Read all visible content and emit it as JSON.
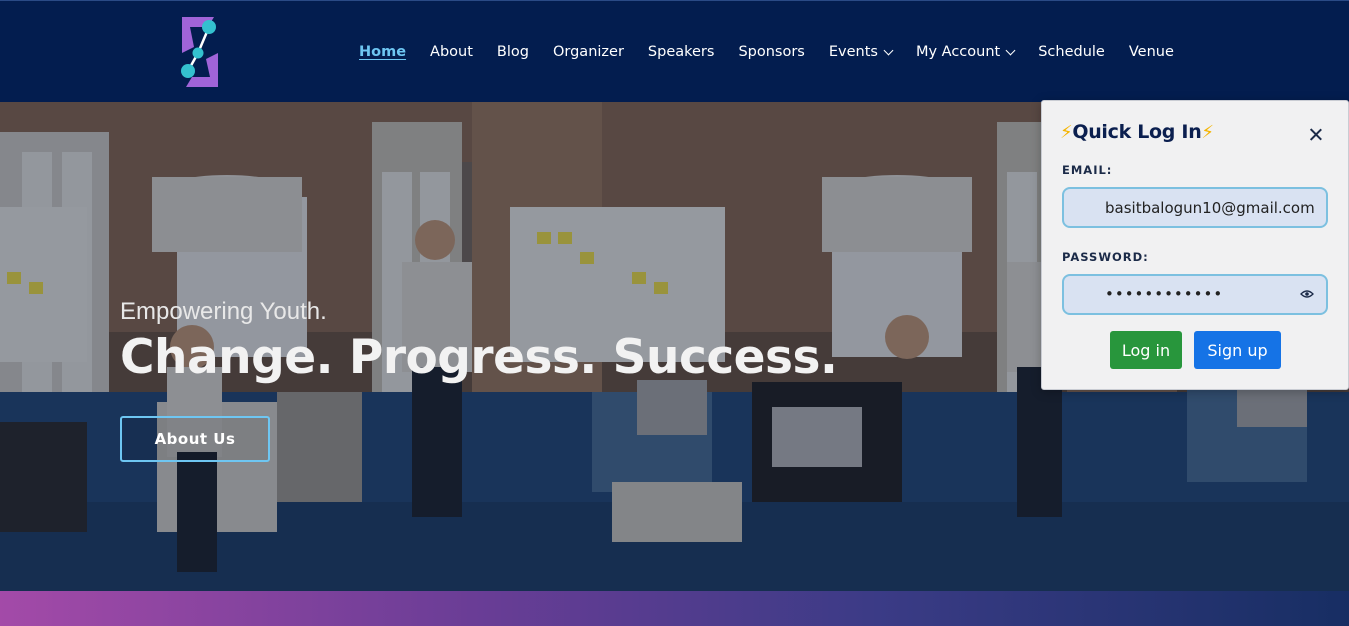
{
  "nav": {
    "items": [
      {
        "label": "Home",
        "active": true,
        "dropdown": false
      },
      {
        "label": "About",
        "active": false,
        "dropdown": false
      },
      {
        "label": "Blog",
        "active": false,
        "dropdown": false
      },
      {
        "label": "Organizer",
        "active": false,
        "dropdown": false
      },
      {
        "label": "Speakers",
        "active": false,
        "dropdown": false
      },
      {
        "label": "Sponsors",
        "active": false,
        "dropdown": false
      },
      {
        "label": "Events",
        "active": false,
        "dropdown": true
      },
      {
        "label": "My Account",
        "active": false,
        "dropdown": true
      },
      {
        "label": "Schedule",
        "active": false,
        "dropdown": false
      },
      {
        "label": "Venue",
        "active": false,
        "dropdown": false
      }
    ]
  },
  "hero": {
    "subtitle": "Empowering Youth.",
    "title": "Change. Progress. Success.",
    "button_label": "About Us"
  },
  "login": {
    "title": "Quick Log In",
    "bolt": "⚡",
    "email_label": "EMAIL:",
    "email_value": "basitbalogun10@gmail.com",
    "password_label": "PASSWORD:",
    "password_masked": "••••••••••••",
    "login_button": "Log in",
    "signup_button": "Sign up"
  },
  "colors": {
    "navbar": "#031d4f",
    "active_link": "#6ec6f2",
    "login_button": "#28963c",
    "signup_button": "#1573e6"
  },
  "icons": [
    "logo-icon",
    "chevron-down-icon",
    "close-icon",
    "eye-icon",
    "bolt-icon"
  ]
}
